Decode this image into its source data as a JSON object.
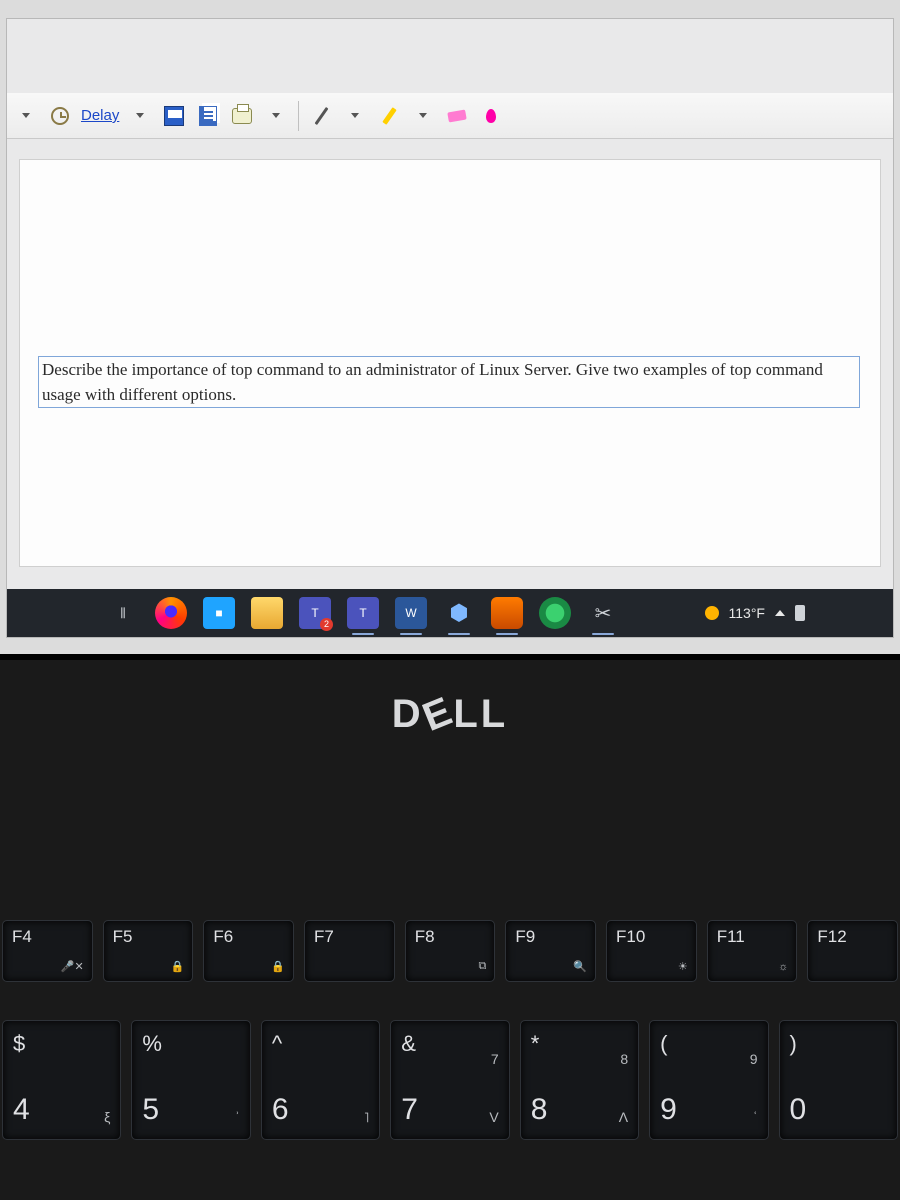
{
  "toolbar": {
    "delay_label": "Delay"
  },
  "document": {
    "paragraph": "Describe the importance of top command to an administrator of Linux Server. Give two examples of top command usage with different options."
  },
  "taskbar": {
    "weather": "113°F"
  },
  "laptop": {
    "brand": "DELL"
  },
  "keys": {
    "f": [
      "F4",
      "F5",
      "F6",
      "F7",
      "F8",
      "F9",
      "F10",
      "F11",
      "F12"
    ],
    "f_icons": [
      "🎤✕",
      "🔒",
      "🔒",
      "",
      "⧉",
      "🔍",
      "☀",
      "☼",
      ""
    ],
    "num": [
      {
        "sym": "$",
        "n": "4",
        "s1": "",
        "s2": "ξ"
      },
      {
        "sym": "%",
        "n": "5",
        "s1": "",
        "s2": "ʾ"
      },
      {
        "sym": "^",
        "n": "6",
        "s1": "",
        "s2": "˥"
      },
      {
        "sym": "&",
        "n": "7",
        "s1": "7",
        "s2": "V"
      },
      {
        "sym": "*",
        "n": "8",
        "s1": "8",
        "s2": "Λ"
      },
      {
        "sym": "(",
        "n": "9",
        "s1": "9",
        "s2": "ʿ"
      },
      {
        "sym": ")",
        "n": "0",
        "s1": "",
        "s2": ""
      }
    ]
  }
}
